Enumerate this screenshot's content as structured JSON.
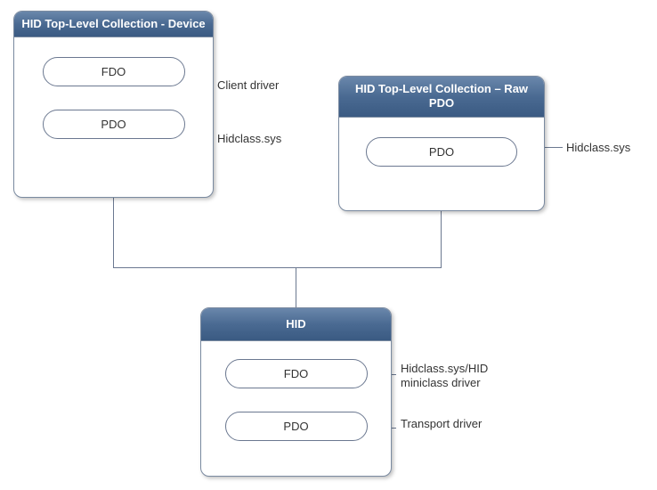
{
  "boxes": {
    "topLeft": {
      "title": "HID Top-Level Collection - Device",
      "pill1": "FDO",
      "pill2": "PDO",
      "label1": "Client driver",
      "label2": "Hidclass.sys"
    },
    "topRight": {
      "title": "HID Top-Level Collection – Raw PDO",
      "pill1": "PDO",
      "label1": "Hidclass.sys"
    },
    "bottom": {
      "title": "HID",
      "pill1": "FDO",
      "pill2": "PDO",
      "label1": "Hidclass.sys/HID miniclass driver",
      "label2": "Transport driver"
    }
  }
}
